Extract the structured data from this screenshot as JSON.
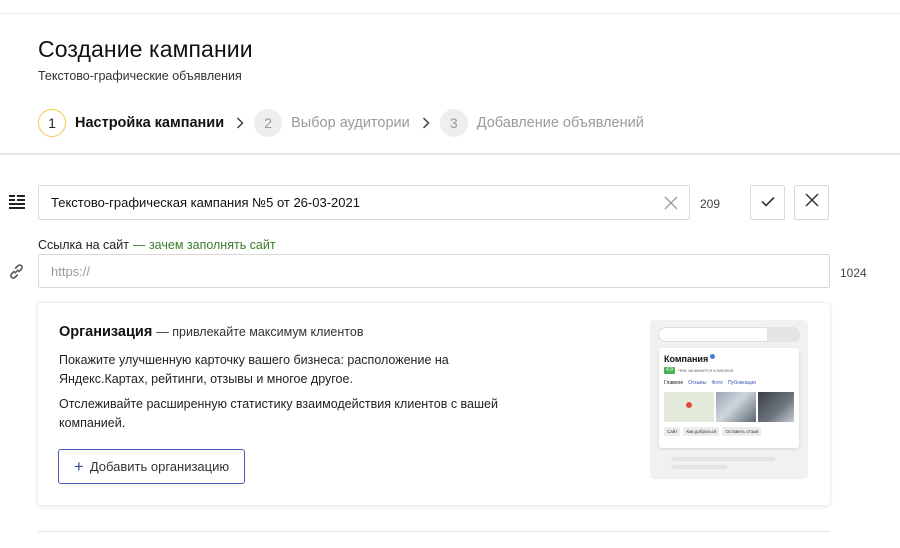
{
  "header": {
    "title": "Создание кампании",
    "subtitle": "Текстово-графические объявления"
  },
  "steps": [
    {
      "number": "1",
      "label": "Настройка кампании",
      "state": "active"
    },
    {
      "number": "2",
      "label": "Выбор аудитории",
      "state": "inactive"
    },
    {
      "number": "3",
      "label": "Добавление объявлений",
      "state": "inactive"
    }
  ],
  "campaign_name": {
    "value": "Текстово-графическая кампания №5 от 26-03-2021",
    "counter": "209"
  },
  "site_link": {
    "label": "Ссылка на сайт",
    "why_link": "— зачем заполнять сайт",
    "placeholder": "https://",
    "value": "",
    "counter": "1024"
  },
  "organization": {
    "title": "Организация",
    "tagline": "— привлекайте максимум клиентов",
    "paragraph_1": "Покажите улучшенную карточку вашего бизнеса: расположение на Яндекс.Картах, рейтинги, отзывы и многое другое.",
    "paragraph_2": "Отслеживайте расширенную статистику взаимодействия клиентов с вашей компанией.",
    "add_button": "Добавить организацию",
    "preview": {
      "company": "Компания",
      "rating": "4.9",
      "rating_text": "Чем занимается компания",
      "tabs": [
        "Главное",
        "Отзывы",
        "Фото",
        "Публикации"
      ],
      "actions": [
        "Сайт",
        "Как добраться",
        "Оставить отзыв"
      ]
    }
  },
  "colors": {
    "active_step_ring": "#f2c94c",
    "link_green": "#3d7a2a",
    "button_border_blue": "#4a5bb5"
  },
  "icons": {
    "campaign_name": "text-lines-icon",
    "site_link": "link-icon",
    "clear": "close-icon",
    "confirm": "check-icon",
    "cancel": "close-icon",
    "add": "plus-icon",
    "step_separator": "chevron-right-icon"
  }
}
